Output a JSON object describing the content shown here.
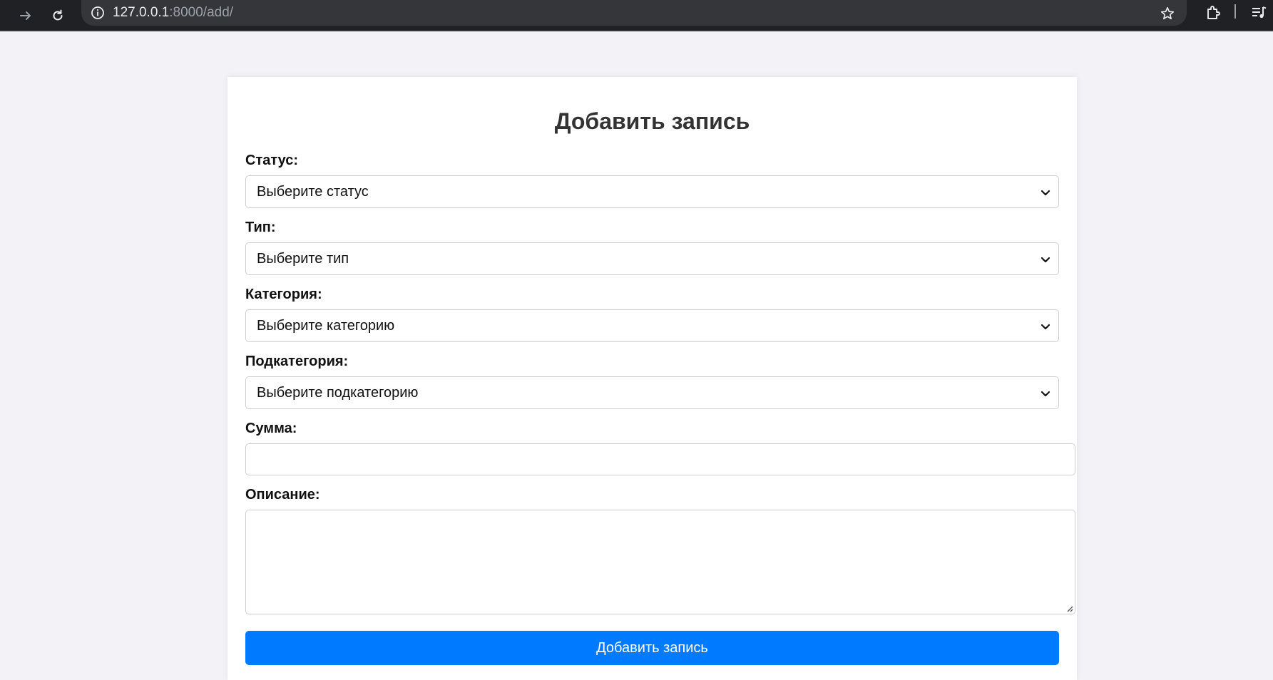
{
  "browser": {
    "url_host": "127.0.0.1",
    "url_rest": ":8000/add/",
    "icons": [
      "forward-icon",
      "reload-icon",
      "site-info-icon",
      "bookmark-star-icon",
      "extensions-icon",
      "media-control-icon"
    ]
  },
  "form": {
    "title": "Добавить запись",
    "status": {
      "label": "Статус:",
      "selected": "Выберите статус"
    },
    "type": {
      "label": "Тип:",
      "selected": "Выберите тип"
    },
    "category": {
      "label": "Категория:",
      "selected": "Выберите категорию"
    },
    "subcategory": {
      "label": "Подкатегория:",
      "selected": "Выберите подкатегорию"
    },
    "amount": {
      "label": "Сумма:",
      "value": ""
    },
    "description": {
      "label": "Описание:",
      "value": ""
    },
    "submit_label": "Добавить запись",
    "accent_color": "#007bff"
  }
}
